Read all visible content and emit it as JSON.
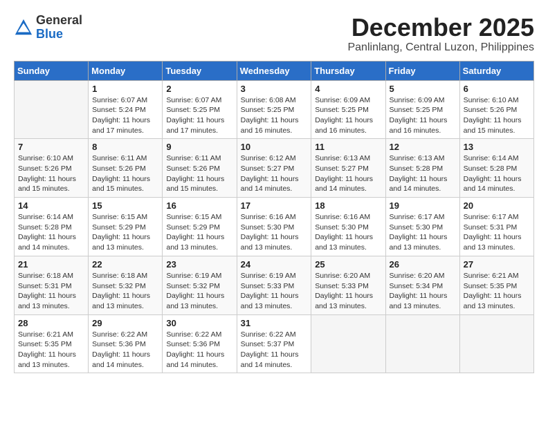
{
  "logo": {
    "general": "General",
    "blue": "Blue"
  },
  "header": {
    "month": "December 2025",
    "location": "Panlinlang, Central Luzon, Philippines"
  },
  "weekdays": [
    "Sunday",
    "Monday",
    "Tuesday",
    "Wednesday",
    "Thursday",
    "Friday",
    "Saturday"
  ],
  "weeks": [
    [
      {
        "day": "",
        "sunrise": "",
        "sunset": "",
        "daylight": ""
      },
      {
        "day": "1",
        "sunrise": "Sunrise: 6:07 AM",
        "sunset": "Sunset: 5:24 PM",
        "daylight": "Daylight: 11 hours and 17 minutes."
      },
      {
        "day": "2",
        "sunrise": "Sunrise: 6:07 AM",
        "sunset": "Sunset: 5:25 PM",
        "daylight": "Daylight: 11 hours and 17 minutes."
      },
      {
        "day": "3",
        "sunrise": "Sunrise: 6:08 AM",
        "sunset": "Sunset: 5:25 PM",
        "daylight": "Daylight: 11 hours and 16 minutes."
      },
      {
        "day": "4",
        "sunrise": "Sunrise: 6:09 AM",
        "sunset": "Sunset: 5:25 PM",
        "daylight": "Daylight: 11 hours and 16 minutes."
      },
      {
        "day": "5",
        "sunrise": "Sunrise: 6:09 AM",
        "sunset": "Sunset: 5:25 PM",
        "daylight": "Daylight: 11 hours and 16 minutes."
      },
      {
        "day": "6",
        "sunrise": "Sunrise: 6:10 AM",
        "sunset": "Sunset: 5:26 PM",
        "daylight": "Daylight: 11 hours and 15 minutes."
      }
    ],
    [
      {
        "day": "7",
        "sunrise": "Sunrise: 6:10 AM",
        "sunset": "Sunset: 5:26 PM",
        "daylight": "Daylight: 11 hours and 15 minutes."
      },
      {
        "day": "8",
        "sunrise": "Sunrise: 6:11 AM",
        "sunset": "Sunset: 5:26 PM",
        "daylight": "Daylight: 11 hours and 15 minutes."
      },
      {
        "day": "9",
        "sunrise": "Sunrise: 6:11 AM",
        "sunset": "Sunset: 5:26 PM",
        "daylight": "Daylight: 11 hours and 15 minutes."
      },
      {
        "day": "10",
        "sunrise": "Sunrise: 6:12 AM",
        "sunset": "Sunset: 5:27 PM",
        "daylight": "Daylight: 11 hours and 14 minutes."
      },
      {
        "day": "11",
        "sunrise": "Sunrise: 6:13 AM",
        "sunset": "Sunset: 5:27 PM",
        "daylight": "Daylight: 11 hours and 14 minutes."
      },
      {
        "day": "12",
        "sunrise": "Sunrise: 6:13 AM",
        "sunset": "Sunset: 5:28 PM",
        "daylight": "Daylight: 11 hours and 14 minutes."
      },
      {
        "day": "13",
        "sunrise": "Sunrise: 6:14 AM",
        "sunset": "Sunset: 5:28 PM",
        "daylight": "Daylight: 11 hours and 14 minutes."
      }
    ],
    [
      {
        "day": "14",
        "sunrise": "Sunrise: 6:14 AM",
        "sunset": "Sunset: 5:28 PM",
        "daylight": "Daylight: 11 hours and 14 minutes."
      },
      {
        "day": "15",
        "sunrise": "Sunrise: 6:15 AM",
        "sunset": "Sunset: 5:29 PM",
        "daylight": "Daylight: 11 hours and 13 minutes."
      },
      {
        "day": "16",
        "sunrise": "Sunrise: 6:15 AM",
        "sunset": "Sunset: 5:29 PM",
        "daylight": "Daylight: 11 hours and 13 minutes."
      },
      {
        "day": "17",
        "sunrise": "Sunrise: 6:16 AM",
        "sunset": "Sunset: 5:30 PM",
        "daylight": "Daylight: 11 hours and 13 minutes."
      },
      {
        "day": "18",
        "sunrise": "Sunrise: 6:16 AM",
        "sunset": "Sunset: 5:30 PM",
        "daylight": "Daylight: 11 hours and 13 minutes."
      },
      {
        "day": "19",
        "sunrise": "Sunrise: 6:17 AM",
        "sunset": "Sunset: 5:30 PM",
        "daylight": "Daylight: 11 hours and 13 minutes."
      },
      {
        "day": "20",
        "sunrise": "Sunrise: 6:17 AM",
        "sunset": "Sunset: 5:31 PM",
        "daylight": "Daylight: 11 hours and 13 minutes."
      }
    ],
    [
      {
        "day": "21",
        "sunrise": "Sunrise: 6:18 AM",
        "sunset": "Sunset: 5:31 PM",
        "daylight": "Daylight: 11 hours and 13 minutes."
      },
      {
        "day": "22",
        "sunrise": "Sunrise: 6:18 AM",
        "sunset": "Sunset: 5:32 PM",
        "daylight": "Daylight: 11 hours and 13 minutes."
      },
      {
        "day": "23",
        "sunrise": "Sunrise: 6:19 AM",
        "sunset": "Sunset: 5:32 PM",
        "daylight": "Daylight: 11 hours and 13 minutes."
      },
      {
        "day": "24",
        "sunrise": "Sunrise: 6:19 AM",
        "sunset": "Sunset: 5:33 PM",
        "daylight": "Daylight: 11 hours and 13 minutes."
      },
      {
        "day": "25",
        "sunrise": "Sunrise: 6:20 AM",
        "sunset": "Sunset: 5:33 PM",
        "daylight": "Daylight: 11 hours and 13 minutes."
      },
      {
        "day": "26",
        "sunrise": "Sunrise: 6:20 AM",
        "sunset": "Sunset: 5:34 PM",
        "daylight": "Daylight: 11 hours and 13 minutes."
      },
      {
        "day": "27",
        "sunrise": "Sunrise: 6:21 AM",
        "sunset": "Sunset: 5:35 PM",
        "daylight": "Daylight: 11 hours and 13 minutes."
      }
    ],
    [
      {
        "day": "28",
        "sunrise": "Sunrise: 6:21 AM",
        "sunset": "Sunset: 5:35 PM",
        "daylight": "Daylight: 11 hours and 13 minutes."
      },
      {
        "day": "29",
        "sunrise": "Sunrise: 6:22 AM",
        "sunset": "Sunset: 5:36 PM",
        "daylight": "Daylight: 11 hours and 14 minutes."
      },
      {
        "day": "30",
        "sunrise": "Sunrise: 6:22 AM",
        "sunset": "Sunset: 5:36 PM",
        "daylight": "Daylight: 11 hours and 14 minutes."
      },
      {
        "day": "31",
        "sunrise": "Sunrise: 6:22 AM",
        "sunset": "Sunset: 5:37 PM",
        "daylight": "Daylight: 11 hours and 14 minutes."
      },
      {
        "day": "",
        "sunrise": "",
        "sunset": "",
        "daylight": ""
      },
      {
        "day": "",
        "sunrise": "",
        "sunset": "",
        "daylight": ""
      },
      {
        "day": "",
        "sunrise": "",
        "sunset": "",
        "daylight": ""
      }
    ]
  ]
}
